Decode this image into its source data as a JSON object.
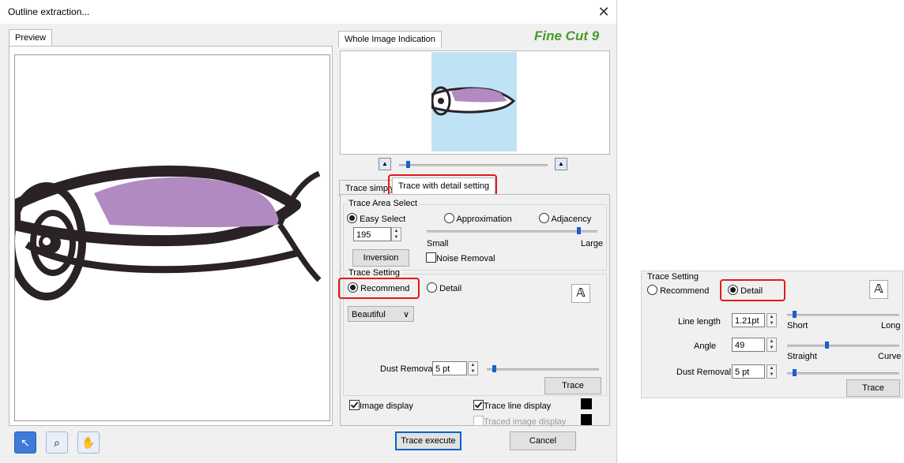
{
  "window": {
    "title": "Outline extraction...",
    "close": "✕"
  },
  "tabs": {
    "preview": "Preview",
    "whole_image": "Whole Image Indication",
    "trace_simply": "Trace simply",
    "trace_detail": "Trace with detail setting"
  },
  "logo": {
    "text": "Fine Cut 9"
  },
  "zoom": {
    "level": 0.05
  },
  "trace_area": {
    "group": "Trace Area Select",
    "easy_select": "Easy Select",
    "approximation": "Approximation",
    "adjacency": "Adjacency",
    "value": "195",
    "slider_level": 0.9,
    "small": "Small",
    "large": "Large",
    "inversion": "Inversion",
    "noise_removal": "Noise Removal"
  },
  "trace_setting": {
    "group": "Trace Setting",
    "recommend": "Recommend",
    "detail": "Detail",
    "style": "Beautiful",
    "dust_label": "Dust Removal",
    "dust_value": "5 pt",
    "dust_level": 0.05,
    "trace_button": "Trace"
  },
  "display": {
    "image_display": "Image display",
    "trace_line_display": "Trace line display",
    "traced_image_display": "Traced image display"
  },
  "buttons": {
    "execute": "Trace execute",
    "cancel": "Cancel"
  },
  "tools": [
    "pointer-icon",
    "magnifier-icon",
    "hand-icon"
  ],
  "inset": {
    "group": "Trace Setting",
    "recommend": "Recommend",
    "detail": "Detail",
    "line_length_label": "Line length",
    "line_length_value": "1.21pt",
    "line_length_level": 0.05,
    "short": "Short",
    "long": "Long",
    "angle_label": "Angle",
    "angle_value": "49",
    "angle_level": 0.35,
    "straight": "Straight",
    "curve": "Curve",
    "dust_label": "Dust Removal",
    "dust_value": "5 pt",
    "dust_level": 0.05,
    "trace_button": "Trace"
  },
  "colors": {
    "fish_body": "#b08ac0",
    "thumbnail_bg": "#bfe3f5",
    "highlight": "#e01a1a",
    "slider": "#1a5fd0"
  }
}
